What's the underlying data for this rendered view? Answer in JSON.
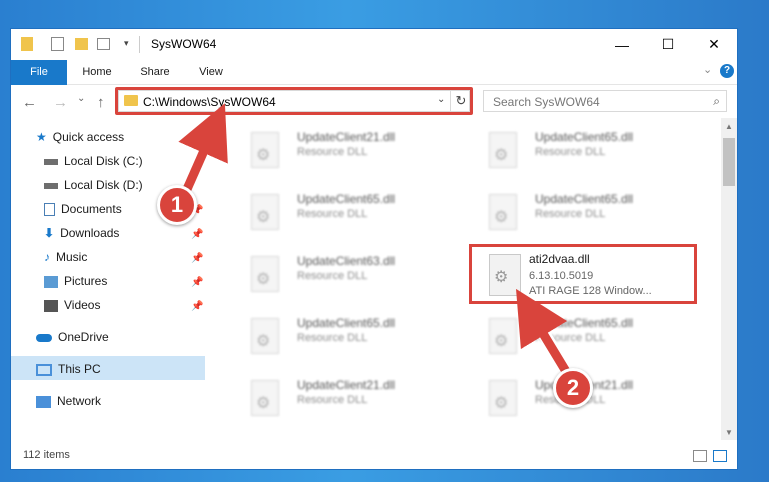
{
  "window": {
    "title": "SysWOW64",
    "minimize": "—",
    "maximize": "☐",
    "close": "✕"
  },
  "ribbon": {
    "tabs": [
      "File",
      "Home",
      "Share",
      "View"
    ],
    "help": "?"
  },
  "nav": {
    "back": "←",
    "forward": "→",
    "recent": "⌄",
    "up": "↑",
    "address": "C:\\Windows\\SysWOW64",
    "search_placeholder": "Search SysWOW64"
  },
  "sidebar": {
    "items": [
      {
        "label": "Quick access",
        "icon": "star-icon"
      },
      {
        "label": "Local Disk (C:)",
        "icon": "drive-icon"
      },
      {
        "label": "Local Disk (D:)",
        "icon": "drive-icon"
      },
      {
        "label": "Documents",
        "icon": "documents-icon"
      },
      {
        "label": "Downloads",
        "icon": "download-icon"
      },
      {
        "label": "Music",
        "icon": "music-icon"
      },
      {
        "label": "Pictures",
        "icon": "pictures-icon"
      },
      {
        "label": "Videos",
        "icon": "videos-icon"
      },
      {
        "label": "OneDrive",
        "icon": "cloud-icon"
      },
      {
        "label": "This PC",
        "icon": "pc-icon"
      },
      {
        "label": "Network",
        "icon": "network-icon"
      }
    ]
  },
  "files": [
    {
      "name": "UpdateClient21.dll",
      "desc": "Resource DLL"
    },
    {
      "name": "UpdateClient65.dll",
      "desc": "Resource DLL"
    },
    {
      "name": "UpdateClient65.dll",
      "desc": "Resource DLL"
    },
    {
      "name": "UpdateClient65.dll",
      "desc": "Resource DLL"
    },
    {
      "name": "UpdateClient63.dll",
      "desc": "Resource DLL"
    },
    {
      "name": "ati2dvaa.dll",
      "version": "6.13.10.5019",
      "desc": "ATI RAGE 128 Window..."
    },
    {
      "name": "UpdateClient65.dll",
      "desc": "Resource DLL"
    },
    {
      "name": "UpdateClient65.dll",
      "desc": "Resource DLL"
    },
    {
      "name": "UpdateClient21.dll",
      "desc": "Resource DLL"
    },
    {
      "name": "UpdateClient21.dll",
      "desc": "Resource DLL"
    }
  ],
  "status": {
    "count": "112 items"
  },
  "annotations": {
    "step1": "1",
    "step2": "2"
  }
}
